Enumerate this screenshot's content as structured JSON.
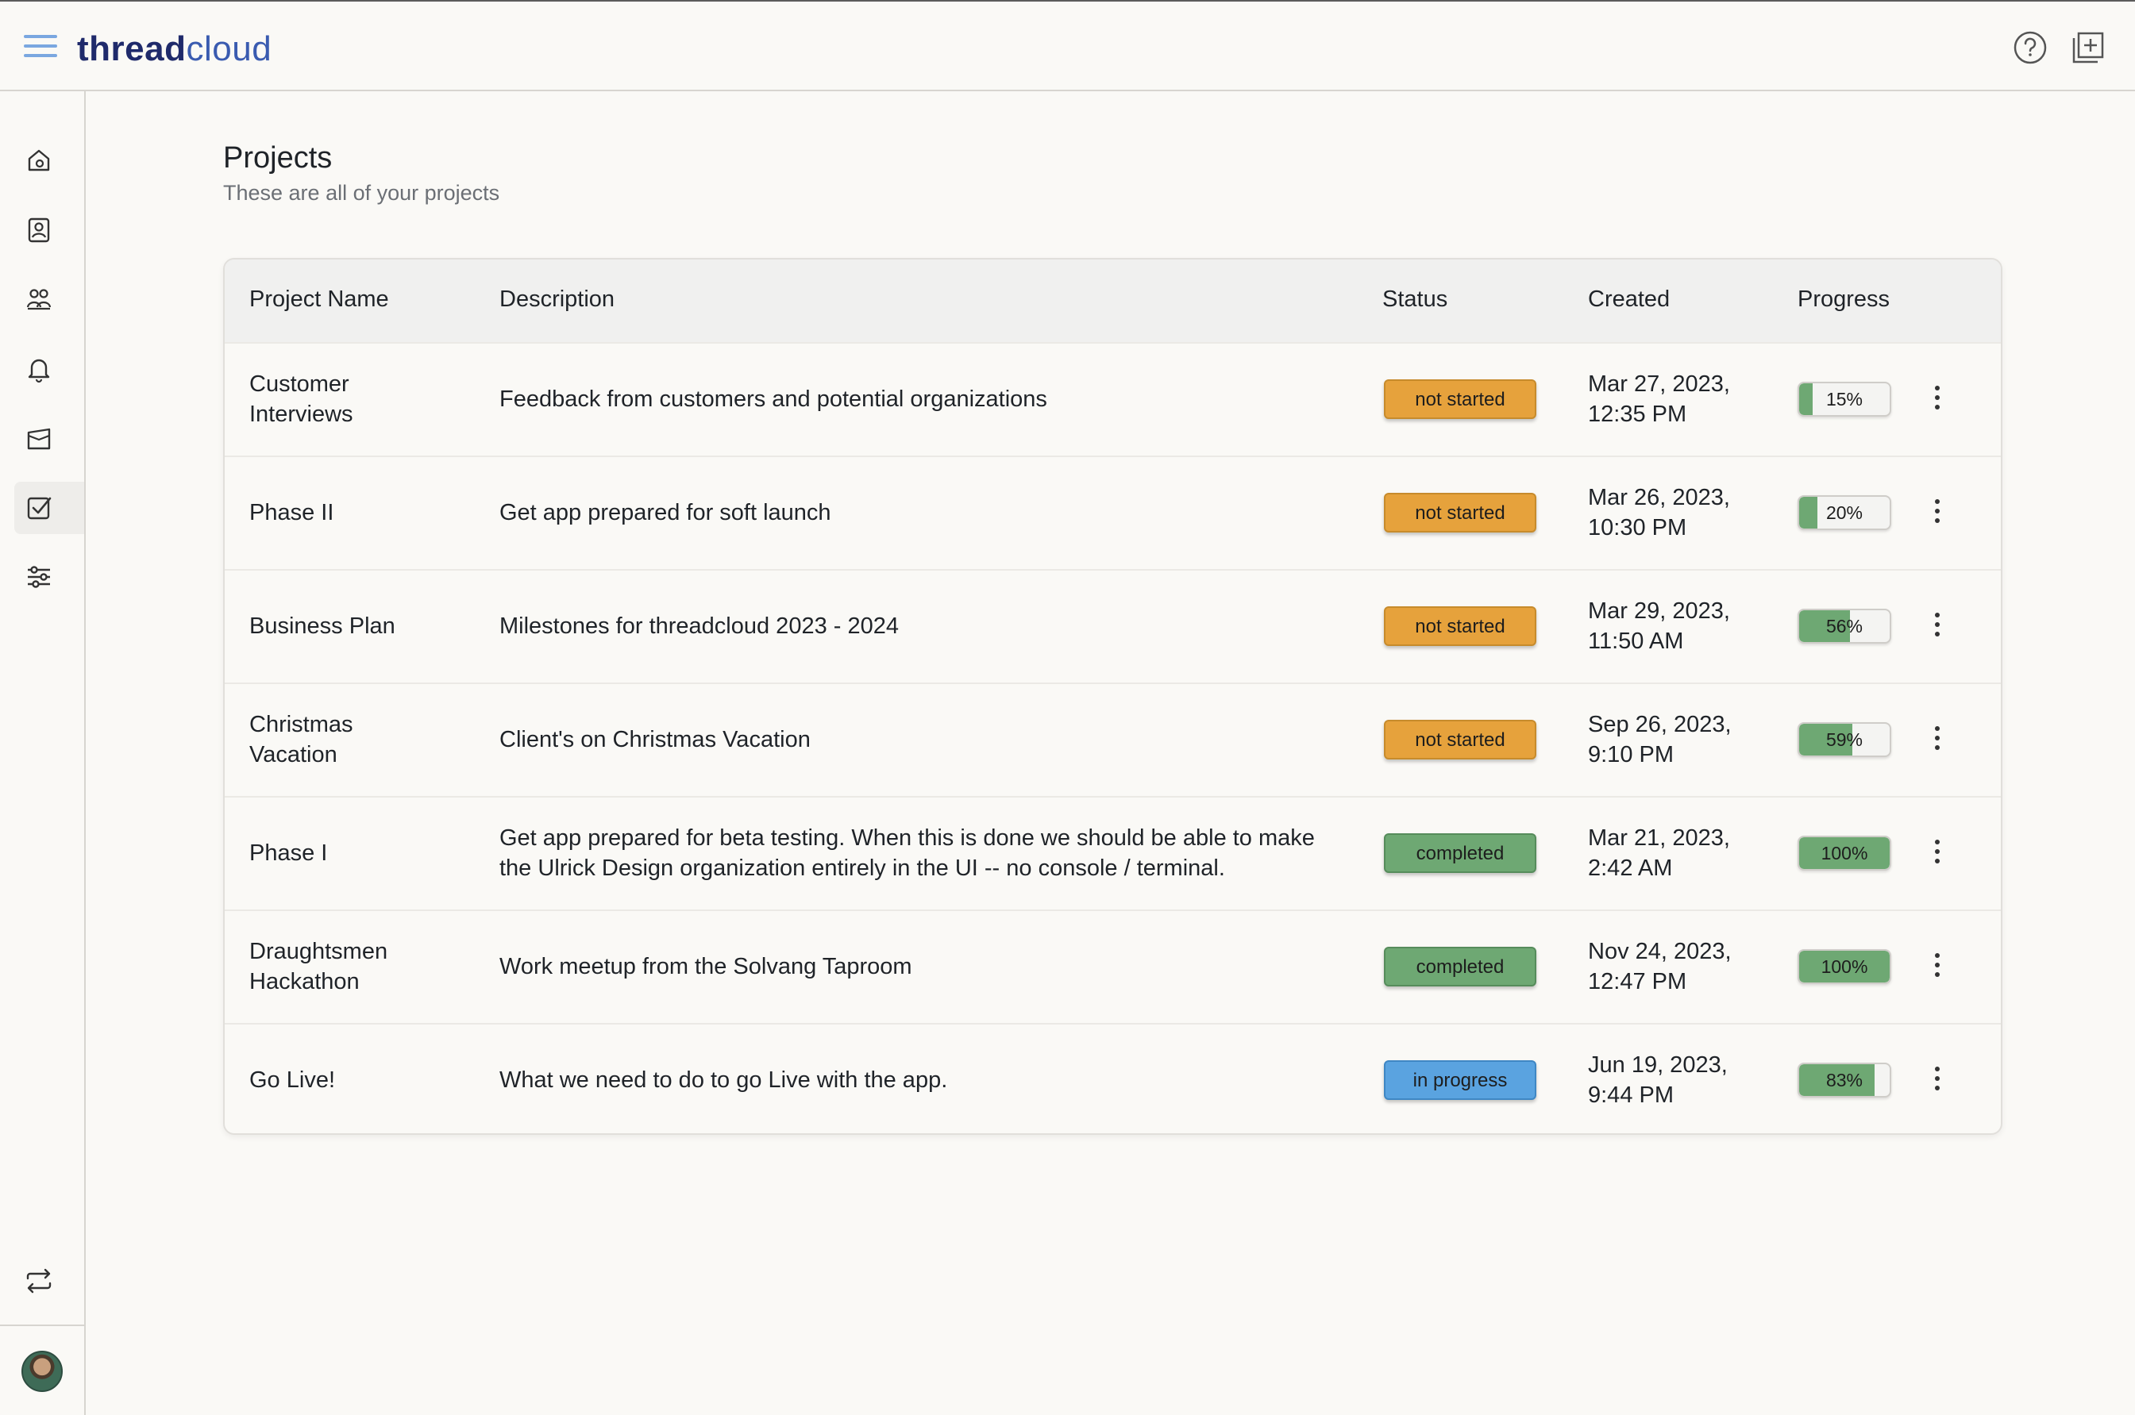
{
  "brand": {
    "part1": "thread",
    "part2": "cloud"
  },
  "sidebar": {
    "items": [
      {
        "icon": "home-icon"
      },
      {
        "icon": "contact-icon"
      },
      {
        "icon": "users-icon"
      },
      {
        "icon": "bell-icon"
      },
      {
        "icon": "inbox-icon"
      },
      {
        "icon": "checkbox-icon",
        "active": true
      },
      {
        "icon": "sliders-icon"
      }
    ],
    "bottom_icon": "switch-icon"
  },
  "header": {
    "help_icon": "help-icon",
    "add_icon": "add-square-icon"
  },
  "page": {
    "title": "Projects",
    "subtitle": "These are all of your projects"
  },
  "table": {
    "columns": [
      "Project Name",
      "Description",
      "Status",
      "Created",
      "Progress"
    ],
    "rows": [
      {
        "name_l1": "Customer",
        "name_l2": "Interviews",
        "desc_l1": "Feedback from customers and potential organizations",
        "desc_l2": "",
        "status": "not started",
        "created_l1": "Mar 27, 2023,",
        "created_l2": "12:35 PM",
        "progress": 15,
        "progress_label": "15%"
      },
      {
        "name_l1": "Phase II",
        "name_l2": "",
        "desc_l1": "Get app prepared for soft launch",
        "desc_l2": "",
        "status": "not started",
        "created_l1": "Mar 26, 2023,",
        "created_l2": "10:30 PM",
        "progress": 20,
        "progress_label": "20%"
      },
      {
        "name_l1": "Business Plan",
        "name_l2": "",
        "desc_l1": "Milestones for threadcloud 2023 - 2024",
        "desc_l2": "",
        "status": "not started",
        "created_l1": "Mar 29, 2023,",
        "created_l2": "11:50 AM",
        "progress": 56,
        "progress_label": "56%"
      },
      {
        "name_l1": "Christmas",
        "name_l2": "Vacation",
        "desc_l1": "Client's on Christmas Vacation",
        "desc_l2": "",
        "status": "not started",
        "created_l1": "Sep 26, 2023,",
        "created_l2": "9:10 PM",
        "progress": 59,
        "progress_label": "59%"
      },
      {
        "name_l1": "Phase I",
        "name_l2": "",
        "desc_l1": "Get app prepared for beta testing. When this is done we should be able to make",
        "desc_l2": "the Ulrick Design organization entirely in the UI -- no console / terminal.",
        "status": "completed",
        "created_l1": "Mar 21, 2023,",
        "created_l2": "2:42 AM",
        "progress": 100,
        "progress_label": "100%"
      },
      {
        "name_l1": "Draughtsmen",
        "name_l2": "Hackathon",
        "desc_l1": "Work meetup from the Solvang Taproom",
        "desc_l2": "",
        "status": "completed",
        "created_l1": "Nov 24, 2023,",
        "created_l2": "12:47 PM",
        "progress": 100,
        "progress_label": "100%"
      },
      {
        "name_l1": "Go Live!",
        "name_l2": "",
        "desc_l1": "What we need to do to go Live with the app.",
        "desc_l2": "",
        "status": "in progress",
        "created_l1": "Jun 19, 2023,",
        "created_l2": "9:44 PM",
        "progress": 83,
        "progress_label": "83%"
      }
    ]
  },
  "colors": {
    "not_started": "#e6a23c",
    "completed": "#6ea873",
    "in_progress": "#5aa3e0",
    "progress_fill": "#6ea873",
    "brand_dark": "#1f2a6b",
    "brand_light": "#3a5bb0"
  }
}
